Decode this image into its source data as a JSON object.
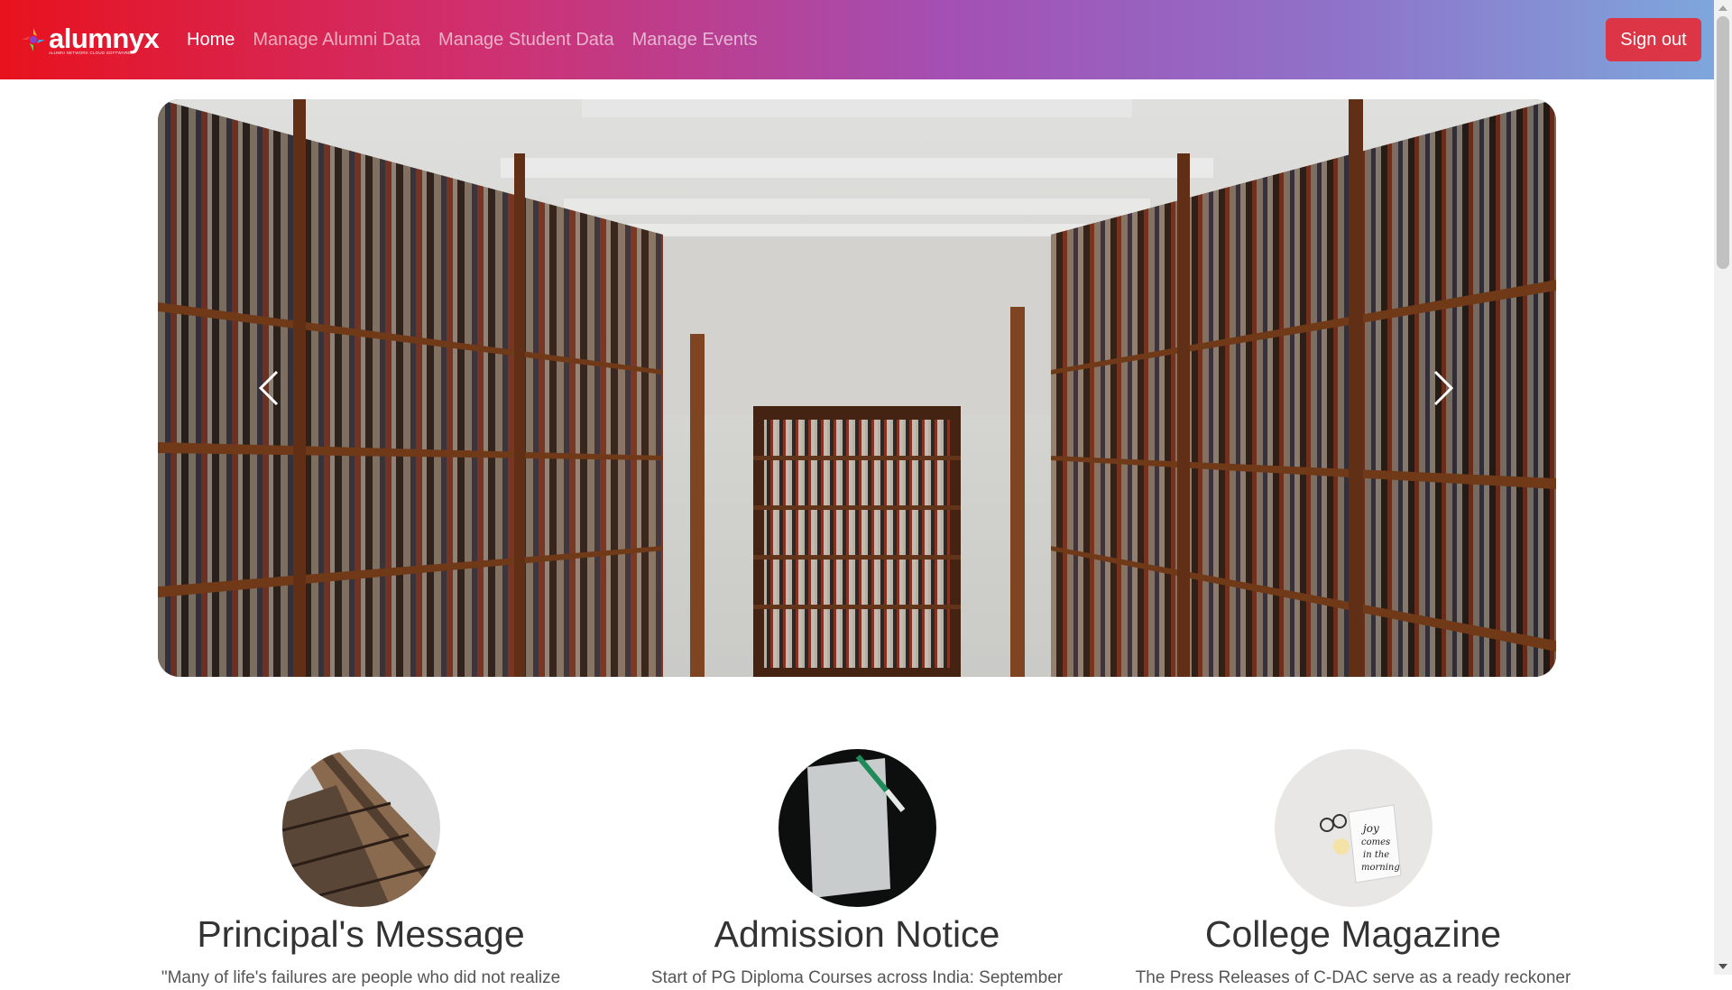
{
  "brand": {
    "name": "alumnyx",
    "tagline": "ALUMNI NETWORK CLOUD SOFTWARE"
  },
  "nav": {
    "links": [
      {
        "label": "Home",
        "active": true
      },
      {
        "label": "Manage Alumni Data",
        "active": false
      },
      {
        "label": "Manage Student Data",
        "active": false
      },
      {
        "label": "Manage Events",
        "active": false
      }
    ],
    "signout_label": "Sign out"
  },
  "carousel": {
    "image": "library-bookshelves",
    "prev_icon": "chevron-left-icon",
    "next_icon": "chevron-right-icon"
  },
  "features": [
    {
      "title": "Principal's Message",
      "text": "\"Many of life's failures are people who did not realize",
      "image": "eiffel-tower"
    },
    {
      "title": "Admission Notice",
      "text": "Start of PG Diploma Courses across India: September",
      "image": "paper-and-pen"
    },
    {
      "title": "College Magazine",
      "text": "The Press Releases of C-DAC serve as a ready reckoner",
      "image": "note-card-joy"
    }
  ],
  "colors": {
    "nav_gradient": [
      "#e8121d",
      "#cf3070",
      "#a44fb3",
      "#8f72c9",
      "#7da7dc"
    ],
    "signout": "#dc3545"
  }
}
